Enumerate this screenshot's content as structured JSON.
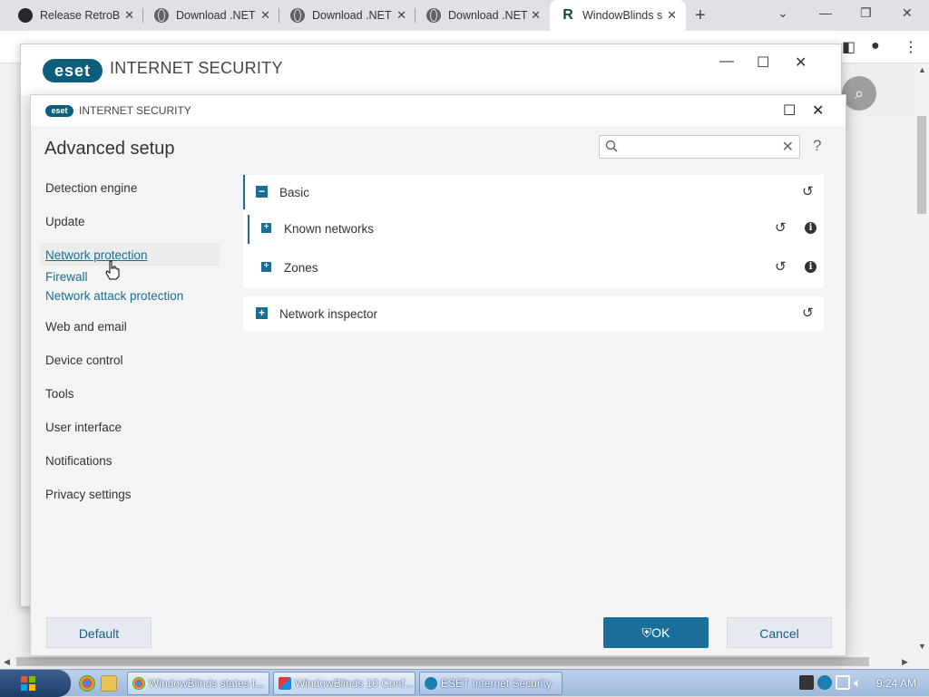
{
  "browser": {
    "tabs": [
      {
        "label": "Release RetroBar",
        "icon": "github-icon",
        "active": false
      },
      {
        "label": "Download .NET",
        "icon": "globe-icon",
        "active": false
      },
      {
        "label": "Download .NET",
        "icon": "globe-icon",
        "active": false
      },
      {
        "label": "Download .NET",
        "icon": "globe-icon",
        "active": false
      },
      {
        "label": "WindowBlinds s",
        "icon": "r-icon",
        "active": true
      }
    ],
    "new_tab": "+",
    "window_controls": {
      "minimize": "—",
      "restore": "❐",
      "close": "✕"
    }
  },
  "eset_main": {
    "logo": "eset",
    "product": "INTERNET SECURITY",
    "controls": {
      "minimize": "—",
      "maximize": "☐",
      "close": "✕"
    }
  },
  "dialog": {
    "logo": "eset",
    "product": "INTERNET SECURITY",
    "controls": {
      "maximize": "☐",
      "close": "✕"
    },
    "heading": "Advanced setup",
    "search": {
      "placeholder": "",
      "value": "",
      "clear": "✕"
    },
    "help": "?",
    "nav": [
      {
        "label": "Detection engine"
      },
      {
        "label": "Update"
      },
      {
        "label": "Network protection",
        "selected": true
      },
      {
        "label": "Firewall",
        "sub": true
      },
      {
        "label": "Network attack protection",
        "sub": true
      },
      {
        "label": "Web and email"
      },
      {
        "label": "Device control"
      },
      {
        "label": "Tools"
      },
      {
        "label": "User interface"
      },
      {
        "label": "Notifications"
      },
      {
        "label": "Privacy settings"
      }
    ],
    "sections": {
      "basic": {
        "label": "Basic",
        "expander": "−"
      },
      "known_networks": {
        "label": "Known networks",
        "expander": "+"
      },
      "zones": {
        "label": "Zones",
        "expander": "+"
      },
      "network_inspector": {
        "label": "Network inspector",
        "expander": "+"
      }
    },
    "reset_glyph": "↺",
    "info_glyph": "i",
    "buttons": {
      "default": "Default",
      "ok": "OK",
      "cancel": "Cancel"
    }
  },
  "taskbar": {
    "tasks": [
      {
        "label": "WindowBlinds states t...",
        "icon": "chrome-icon"
      },
      {
        "label": "WindowBlinds 10 Conf...",
        "icon": "windowblinds-icon"
      },
      {
        "label": "ESET Internet Security",
        "icon": "eset-icon"
      }
    ],
    "clock": "9:24 AM"
  }
}
